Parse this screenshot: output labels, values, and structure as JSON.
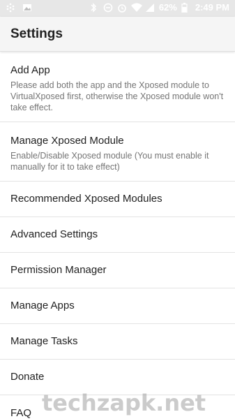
{
  "status_bar": {
    "left_icons": [
      "dots-grid-icon",
      "image-icon"
    ],
    "right_icons": [
      "bluetooth-icon",
      "do-not-disturb-icon",
      "alarm-icon",
      "wifi-icon",
      "signal-icon",
      "battery-icon"
    ],
    "battery": "62%",
    "time": "2:49 PM"
  },
  "app_bar": {
    "title": "Settings"
  },
  "settings": {
    "items": [
      {
        "label": "Add App",
        "summary": "Please add both the app and the Xposed module to VirtualXposed first, otherwise the Xposed module won't take effect."
      },
      {
        "label": "Manage Xposed Module",
        "summary": "Enable/Disable Xposed module (You must enable it manually for it to take effect)"
      },
      {
        "label": "Recommended Xposed Modules"
      },
      {
        "label": "Advanced Settings"
      },
      {
        "label": "Permission Manager"
      },
      {
        "label": "Manage Apps"
      },
      {
        "label": "Manage Tasks"
      },
      {
        "label": "Donate"
      },
      {
        "label": "FAQ"
      }
    ]
  },
  "watermark": "techzapk.net",
  "colors": {
    "status_bar": "#e7e7e7",
    "app_bar": "#f5f5f5",
    "divider": "#e3e3e3",
    "summary_text": "#757575"
  }
}
